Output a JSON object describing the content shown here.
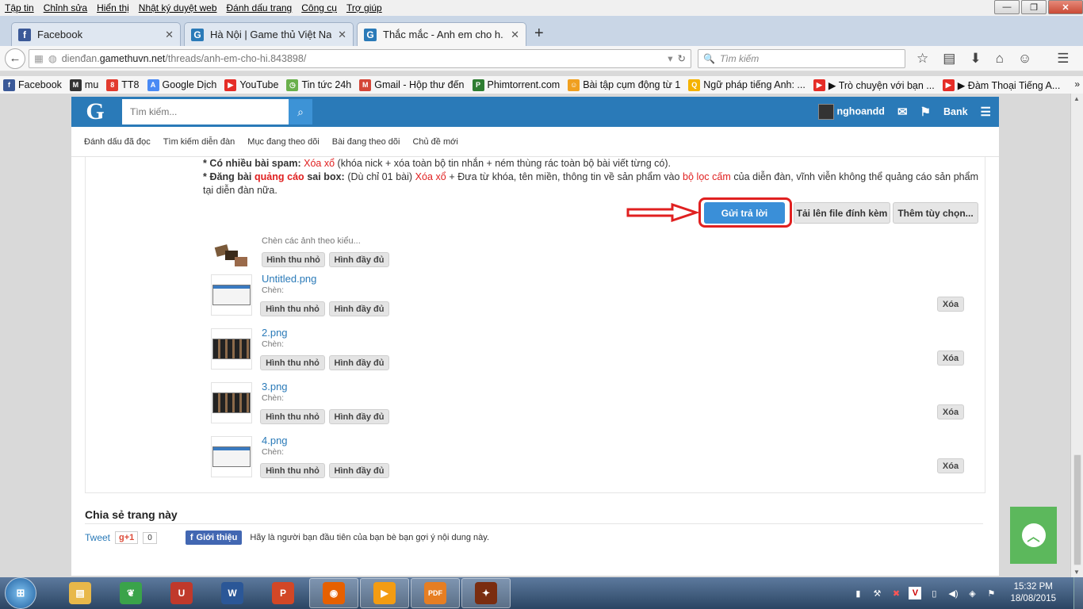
{
  "menubar": [
    "Tập tin",
    "Chỉnh sửa",
    "Hiển thị",
    "Nhật ký duyệt web",
    "Đánh dấu trang",
    "Công cụ",
    "Trợ giúp"
  ],
  "tabs": [
    {
      "title": "Facebook",
      "icon": "facebook-icon",
      "color": "#3b5998"
    },
    {
      "title": "Hà Nội | Game thủ Việt Na...",
      "icon": "gamethuvn-icon",
      "color": "#2a7ab8"
    },
    {
      "title": "Thắc mắc - Anh em cho h...",
      "icon": "gamethuvn-icon",
      "color": "#2a7ab8"
    }
  ],
  "nav": {
    "url_prefix": "dienđan.",
    "url_host": "gamethuvn.net",
    "url_path": "/threads/anh-em-cho-hi.843898/",
    "search_placeholder": "Tìm kiếm"
  },
  "bookmarks": [
    {
      "label": "Facebook",
      "icon": "facebook-icon",
      "color": "#3b5998",
      "glyph": "f"
    },
    {
      "label": "mu",
      "icon": "mu-icon",
      "color": "#333",
      "glyph": "M"
    },
    {
      "label": "TT8",
      "icon": "tt8-icon",
      "color": "#e23b2e",
      "glyph": "8"
    },
    {
      "label": "Google Dịch",
      "icon": "google-translate-icon",
      "color": "#4a8af4",
      "glyph": "A"
    },
    {
      "label": "YouTube",
      "icon": "youtube-icon",
      "color": "#e52d27",
      "glyph": "▶"
    },
    {
      "label": "Tin tức 24h",
      "icon": "news-icon",
      "color": "#6ab04c",
      "glyph": "◷"
    },
    {
      "label": "Gmail - Hộp thư đến",
      "icon": "gmail-icon",
      "color": "#d44638",
      "glyph": "M"
    },
    {
      "label": "Phimtorrent.com",
      "icon": "phimtorrent-icon",
      "color": "#2e7d32",
      "glyph": "P"
    },
    {
      "label": "Bài tập cụm động từ 1",
      "icon": "exercise-icon",
      "color": "#f0a020",
      "glyph": "☺"
    },
    {
      "label": "Ngữ pháp tiếng Anh: ...",
      "icon": "grammar-icon",
      "color": "#f5b300",
      "glyph": "Q"
    },
    {
      "label": "▶ Trò chuyện với bạn ...",
      "icon": "youtube-icon",
      "color": "#e52d27",
      "glyph": "▶"
    },
    {
      "label": "▶ Đàm Thoại Tiếng A...",
      "icon": "youtube-icon",
      "color": "#e52d27",
      "glyph": "▶"
    }
  ],
  "site": {
    "logo": "G",
    "search_placeholder": "Tìm kiếm...",
    "username": "nghoandd",
    "bank": "Bank",
    "subnav": [
      "Đánh dấu đã đọc",
      "Tìm kiếm diễn đàn",
      "Mục đang theo dõi",
      "Bài đang theo dõi",
      "Chủ đề mới"
    ]
  },
  "rules": {
    "line1_lead": "* Có nhiều bài spam:",
    "line1_red": "Xóa xổ",
    "line1_rest": "(khóa nick + xóa toàn bộ tin nhắn + ném thùng rác toàn bộ bài viết từng có).",
    "line2_lead": "* Đăng bài",
    "line2_ad": "quảng cáo",
    "line2_box": "sai box:",
    "line2_a": "(Dù chỉ 01 bài)",
    "line2_red": "Xóa xổ",
    "line2_b": "+ Đưa từ khóa, tên miền, thông tin về sản phẩm vào",
    "line2_filter": "bộ lọc cấm",
    "line2_c": "của diễn đàn, vĩnh viễn không thể quảng cáo sản phẩm tại diễn đàn nữa."
  },
  "buttons": {
    "reply": "Gửi trả lời",
    "upload": "Tải lên file đính kèm",
    "more": "Thêm tùy chọn..."
  },
  "insert_all": {
    "label": "Chèn các ảnh theo kiểu...",
    "thumb": "Hình thu nhỏ",
    "full": "Hình đầy đủ"
  },
  "attachments": [
    {
      "name": "Untitled.png",
      "insert_label": "Chèn:",
      "thumb": "Hình thu nhỏ",
      "full": "Hình đầy đủ",
      "delete": "Xóa"
    },
    {
      "name": "2.png",
      "insert_label": "Chèn:",
      "thumb": "Hình thu nhỏ",
      "full": "Hình đầy đủ",
      "delete": "Xóa"
    },
    {
      "name": "3.png",
      "insert_label": "Chèn:",
      "thumb": "Hình thu nhỏ",
      "full": "Hình đầy đủ",
      "delete": "Xóa"
    },
    {
      "name": "4.png",
      "insert_label": "Chèn:",
      "thumb": "Hình thu nhỏ",
      "full": "Hình đầy đủ",
      "delete": "Xóa"
    }
  ],
  "share": {
    "title": "Chia sẻ trang này",
    "tweet": "Tweet",
    "gplus": "g+1",
    "gplus_count": "0",
    "fb_button": "Giới thiệu",
    "fb_text": "Hãy là người bạn đầu tiên của bạn bè bạn gợi ý nội dung này."
  },
  "taskbar": {
    "apps": [
      {
        "icon": "file-explorer-icon",
        "color": "#e8b84a",
        "glyph": "▤"
      },
      {
        "icon": "parrot-icon",
        "color": "#3aa34a",
        "glyph": "❦"
      },
      {
        "icon": "unikey-icon",
        "color": "#c0392b",
        "glyph": "U"
      },
      {
        "icon": "word-icon",
        "color": "#2b5797",
        "glyph": "W"
      },
      {
        "icon": "powerpoint-icon",
        "color": "#d24726",
        "glyph": "P"
      },
      {
        "icon": "firefox-icon",
        "color": "#e66000",
        "glyph": "◉"
      },
      {
        "icon": "media-player-icon",
        "color": "#f39c12",
        "glyph": "▶"
      },
      {
        "icon": "pdf-icon",
        "color": "#e67e22",
        "glyph": "PDF"
      },
      {
        "icon": "game-icon",
        "color": "#7a2d10",
        "glyph": "✦"
      }
    ],
    "time": "15:32 PM",
    "date": "18/08/2015"
  }
}
